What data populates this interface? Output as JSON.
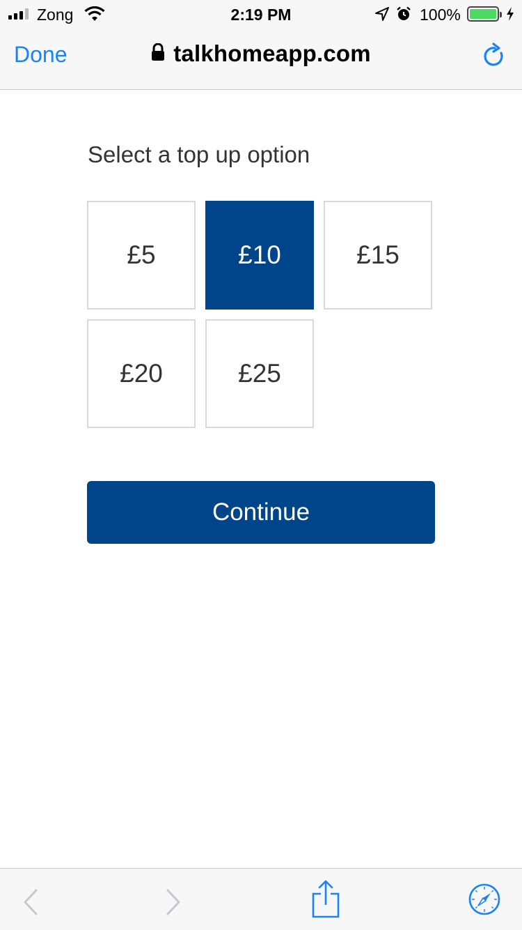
{
  "status_bar": {
    "carrier": "Zong",
    "time": "2:19 PM",
    "battery_percent": "100%",
    "signal_bars_active": 3,
    "signal_bars_total": 4
  },
  "browser": {
    "done_label": "Done",
    "url": "talkhomeapp.com",
    "accent_color": "#1a82fb"
  },
  "topup": {
    "heading": "Select a top up option",
    "options": [
      {
        "label": "£5",
        "selected": false
      },
      {
        "label": "£10",
        "selected": true
      },
      {
        "label": "£15",
        "selected": false
      },
      {
        "label": "£20",
        "selected": false
      },
      {
        "label": "£25",
        "selected": false
      }
    ],
    "continue_label": "Continue",
    "brand_color": "#004489"
  },
  "toolbar": {
    "icons": [
      "back-icon",
      "forward-icon",
      "share-icon",
      "compass-icon"
    ]
  }
}
